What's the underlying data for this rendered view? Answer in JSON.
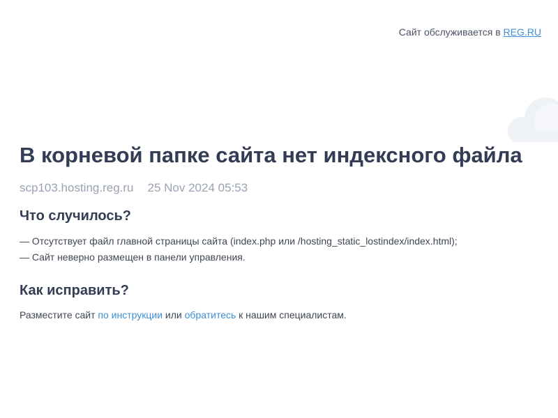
{
  "header": {
    "served_text": "Сайт обслуживается в ",
    "provider_link": "REG.RU"
  },
  "main": {
    "title": "В корневой папке сайта нет индексного файла",
    "host": "scp103.hosting.reg.ru",
    "datetime": "25 Nov 2024 05:53",
    "what_happened": {
      "heading": "Что случилось?",
      "items": [
        "— Отсутствует файл главной страницы сайта (index.php или /hosting_static_lostindex/index.html);",
        "— Сайт неверно размещен в панели управления."
      ]
    },
    "how_to_fix": {
      "heading": "Как исправить?",
      "text_before": "Разместите сайт ",
      "link_instructions": "по инструкции",
      "text_middle": " или ",
      "link_contact": "обратитесь",
      "text_after": " к нашим специалистам."
    }
  },
  "colors": {
    "title": "#323c55",
    "meta": "#9aa2b1",
    "link": "#3c8fd6",
    "cloud": "#eef1f6"
  },
  "icons": {
    "cloud": "cloud-icon"
  }
}
